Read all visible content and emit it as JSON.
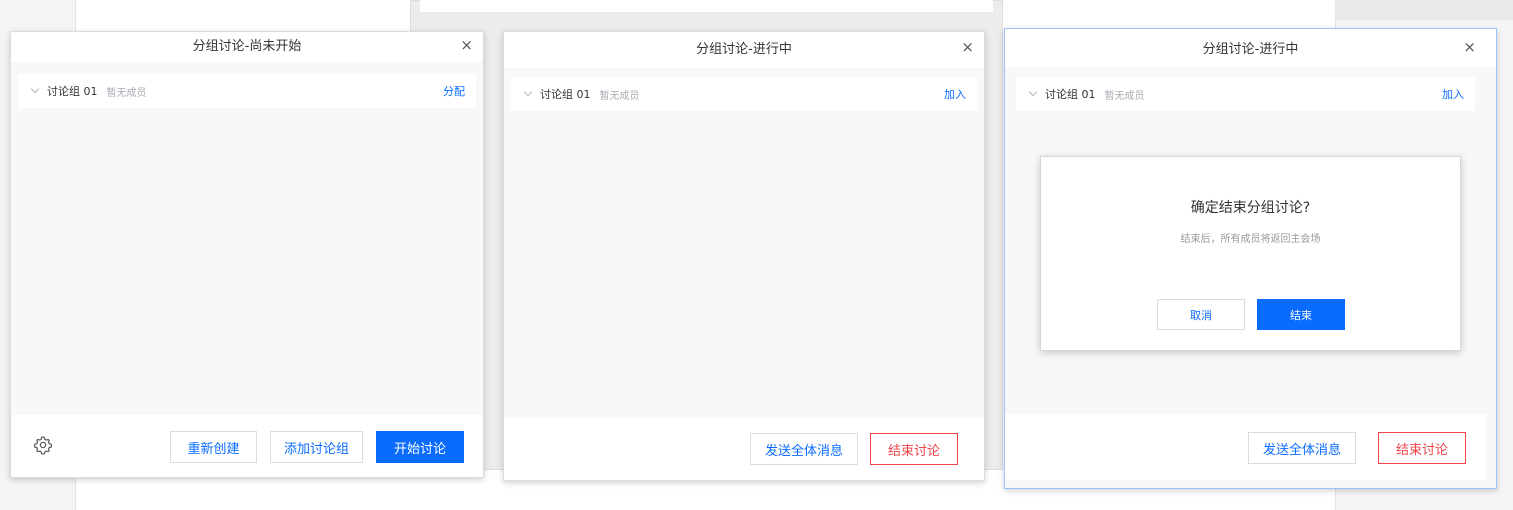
{
  "panels": [
    {
      "title": "分组讨论-尚未开始",
      "close_icon": "×",
      "group": {
        "name": "讨论组 01",
        "status": "暂无成员",
        "action": "分配"
      },
      "footer": {
        "recreate": "重新创建",
        "add_group": "添加讨论组",
        "start": "开始讨论",
        "settings_icon": "gear-icon"
      }
    },
    {
      "title": "分组讨论-进行中",
      "close_icon": "×",
      "group": {
        "name": "讨论组 01",
        "status": "暂无成员",
        "action": "加入"
      },
      "footer": {
        "broadcast": "发送全体消息",
        "end": "结束讨论"
      }
    },
    {
      "title": "分组讨论-进行中",
      "close_icon": "×",
      "group": {
        "name": "讨论组 01",
        "status": "暂无成员",
        "action": "加入"
      },
      "footer": {
        "broadcast": "发送全体消息",
        "end": "结束讨论"
      },
      "dialog": {
        "title": "确定结束分组讨论?",
        "message": "结束后，所有成员将返回主会场",
        "cancel": "取消",
        "confirm": "结束"
      }
    }
  ],
  "colors": {
    "accent": "#0a6cff",
    "danger": "#f0444a",
    "muted": "#a7abb3",
    "panel_bg": "#f7f8fa"
  }
}
